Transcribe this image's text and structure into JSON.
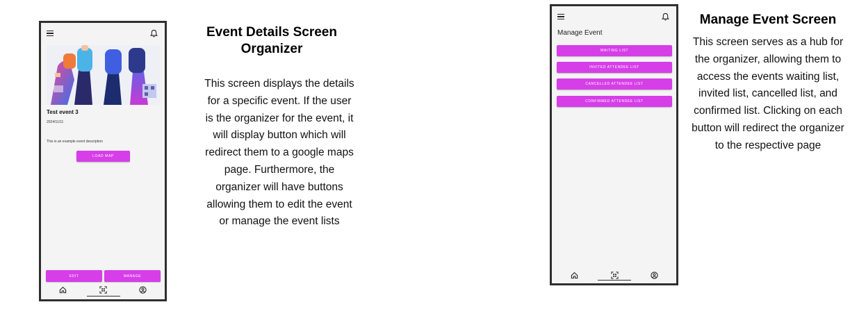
{
  "left_panel": {
    "heading_line1": "Event Details Screen",
    "heading_line2": "Organizer",
    "description": "This screen displays the details for a specific event. If the user is the organizer for the event, it will display button which will redirect them to a google maps page. Furthermore, the organizer will have buttons allowing them to edit the event or manage the event lists",
    "phone": {
      "event_title": "Test event 3",
      "event_date": "2024/11/11",
      "event_description": "This is an example event description",
      "load_map_label": "LOAD MAP",
      "edit_label": "EDIT",
      "manage_label": "MANAGE"
    }
  },
  "right_panel": {
    "heading": "Manage Event Screen",
    "description": "This screen serves as a hub for the organizer, allowing them to access the events waiting list, invited list, cancelled list, and confirmed list. Clicking on each button will redirect the organizer to the respective page",
    "phone": {
      "screen_title": "Manage Event",
      "buttons": [
        "WAITING LIST",
        "INVITED ATTENDEE LIST",
        "CANCELLED ATTENDEE LIST",
        "CONFIRMED ATTENDEE LIST"
      ]
    }
  },
  "nav_icons": [
    "home-icon",
    "qr-scan-icon",
    "profile-icon"
  ],
  "colors": {
    "accent": "#d63ee8",
    "phone_bg": "#f4f4f4",
    "phone_frame": "#2f2f2f"
  }
}
